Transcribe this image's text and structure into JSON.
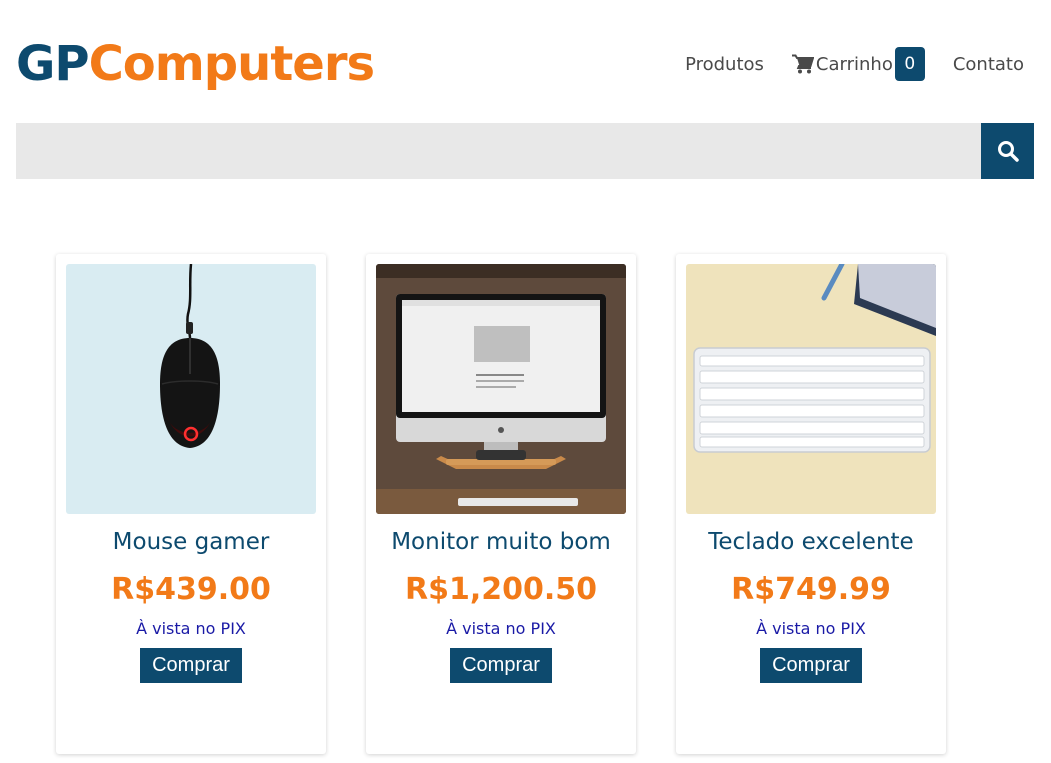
{
  "brand": {
    "part1": "GP",
    "part2": "Computers"
  },
  "nav": {
    "produtos": "Produtos",
    "carrinho": "Carrinho",
    "cart_count": "0",
    "contato": "Contato"
  },
  "search": {
    "placeholder": "",
    "value": ""
  },
  "products": [
    {
      "name": "Mouse gamer",
      "price": "R$439.00",
      "payment": "À vista no PIX",
      "buy_label": "Comprar"
    },
    {
      "name": "Monitor muito bom",
      "price": "R$1,200.50",
      "payment": "À vista no PIX",
      "buy_label": "Comprar"
    },
    {
      "name": "Teclado excelente",
      "price": "R$749.99",
      "payment": "À vista no PIX",
      "buy_label": "Comprar"
    }
  ],
  "colors": {
    "brand_blue": "#0d4a6e",
    "brand_orange": "#f27a18",
    "pix_blue": "#1a1aa6"
  }
}
